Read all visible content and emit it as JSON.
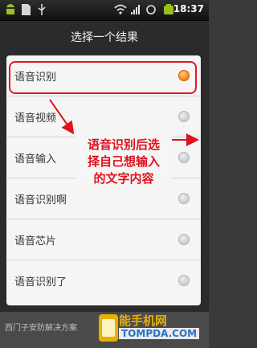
{
  "statusbar": {
    "time": "18:37",
    "icons": [
      "android-icon",
      "usb-icon",
      "wifi-icon",
      "signal-icon",
      "battery-icon"
    ]
  },
  "dialog": {
    "title": "选择一个结果",
    "items": [
      {
        "label": "语音识别",
        "selected": true
      },
      {
        "label": "语音视频",
        "selected": false
      },
      {
        "label": "语音输入",
        "selected": false
      },
      {
        "label": "语音识别啊",
        "selected": false
      },
      {
        "label": "语音芯片",
        "selected": false
      },
      {
        "label": "语音识别了",
        "selected": false
      }
    ]
  },
  "annotation": {
    "lines": [
      "语音识别后选",
      "择自己想输入",
      "的文字内容"
    ],
    "color": "#e0121c"
  },
  "ad": {
    "text": "西门子安防解决方案"
  },
  "watermark": {
    "name": "能手机网",
    "url": "TOMPDA.COM"
  },
  "colors": {
    "highlight": "#e8141f",
    "radio_selected": "#f07d10"
  }
}
